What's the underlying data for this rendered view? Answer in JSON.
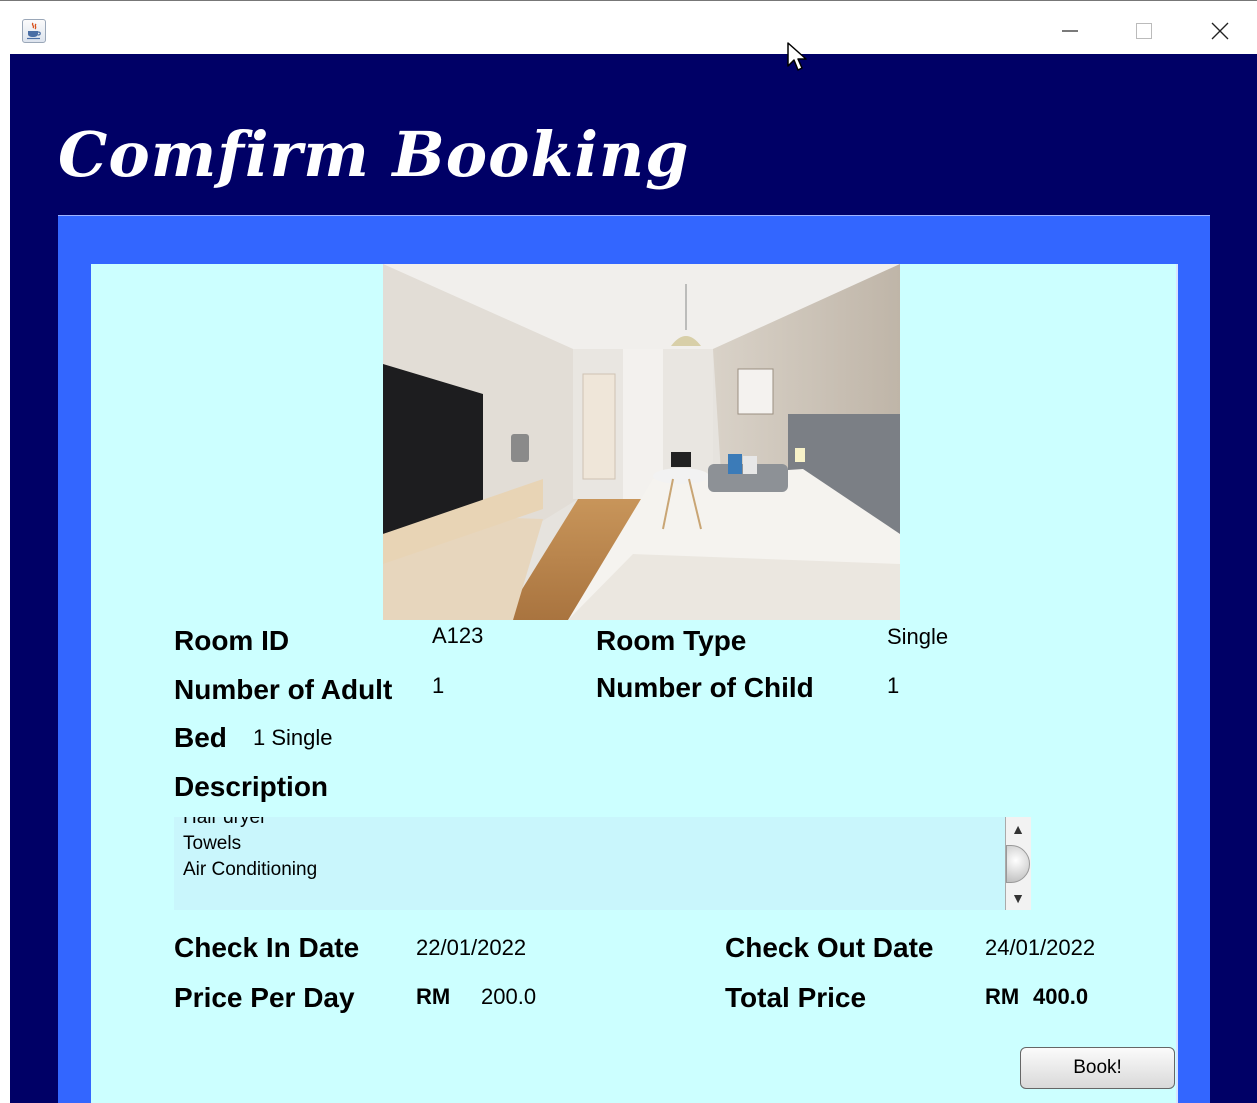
{
  "window": {
    "minimize_label": "—",
    "maximize_label": "☐",
    "close_label": "✕"
  },
  "page": {
    "title": "Comfirm Booking"
  },
  "room": {
    "id_label": "Room ID",
    "id_value": "A123",
    "type_label": "Room Type",
    "type_value": "Single",
    "adult_label": "Number of Adult",
    "adult_value": "1",
    "child_label": "Number of Child",
    "child_value": "1",
    "bed_label": "Bed",
    "bed_value": "1 Single",
    "description_label": "Description",
    "description_lines": [
      "Hair dryer",
      "Towels",
      "Air Conditioning"
    ]
  },
  "booking": {
    "checkin_label": "Check In Date",
    "checkin_value": "22/01/2022",
    "checkout_label": "Check Out Date",
    "checkout_value": "24/01/2022",
    "price_label": "Price Per Day",
    "price_currency": "RM",
    "price_value": "200.0",
    "total_label": "Total Price",
    "total_currency": "RM",
    "total_value": "400.0",
    "book_button": "Book!"
  },
  "colors": {
    "frame_bg": "#000066",
    "outer_panel": "#3366ff",
    "inner_panel": "#ccffff",
    "description_bg": "#c9f6fc"
  },
  "icons": {
    "app": "java-cup-icon",
    "minimize": "minimize-icon",
    "maximize": "maximize-icon",
    "close": "close-icon",
    "scroll_up": "arrow-up-icon",
    "scroll_down": "arrow-down-icon",
    "cursor": "mouse-pointer-icon"
  }
}
